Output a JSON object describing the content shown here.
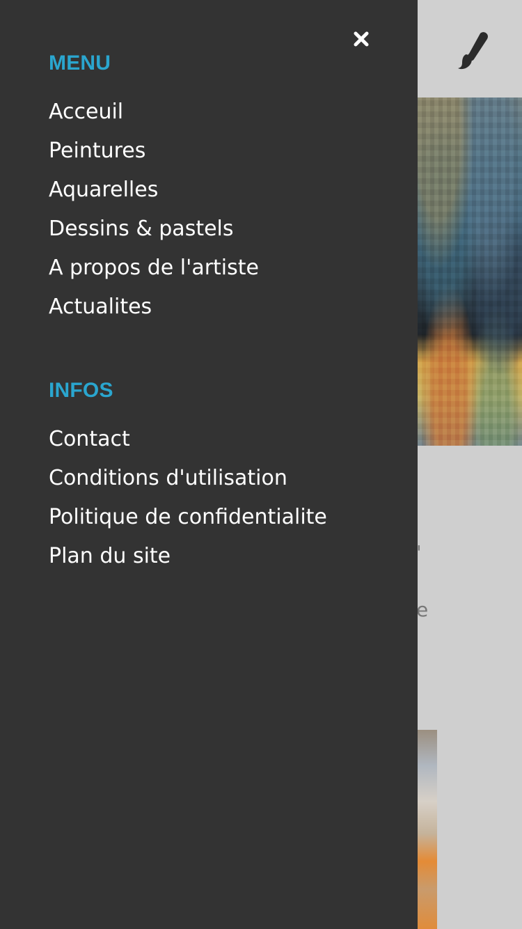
{
  "theme": {
    "drawer_background": "#333333",
    "section_title_color": "#2aa6cf",
    "menu_text_color": "#ffffff",
    "page_background": "#cfcfcf"
  },
  "drawer": {
    "close_icon": "close-icon",
    "sections": {
      "menu": {
        "title": "MENU",
        "items": [
          {
            "label": "Acceuil"
          },
          {
            "label": "Peintures"
          },
          {
            "label": "Aquarelles"
          },
          {
            "label": "Dessins & pastels"
          },
          {
            "label": "A propos de l'artiste"
          },
          {
            "label": "Actualites"
          }
        ]
      },
      "infos": {
        "title": "INFOS",
        "items": [
          {
            "label": "Contact"
          },
          {
            "label": "Conditions d'utilisation"
          },
          {
            "label": "Politique de confidentialite"
          },
          {
            "label": "Plan du site"
          }
        ]
      }
    }
  },
  "background_page": {
    "header_icon": "paintbrush-icon",
    "text_fragments": [
      "'",
      "e"
    ]
  }
}
